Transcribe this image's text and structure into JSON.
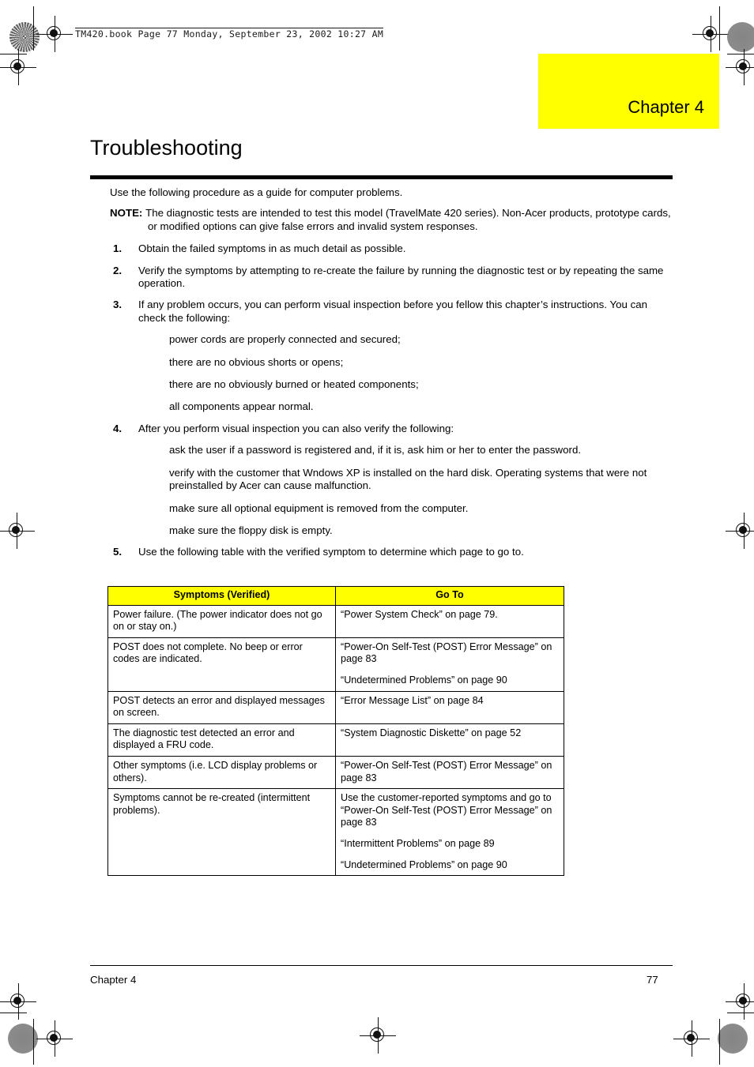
{
  "running_head": "TM420.book  Page 77  Monday, September 23, 2002  10:27 AM",
  "chapter_banner": {
    "label": "Chapter 4",
    "background_color": "#ffff00"
  },
  "title": "Troubleshooting",
  "intro": "Use the following procedure as a guide for computer problems.",
  "note": {
    "label": "NOTE:",
    "text": "The diagnostic tests are intended to test this model (TravelMate 420 series).  Non-Acer products, prototype cards, or modified options can give false errors and invalid system responses."
  },
  "steps": [
    {
      "num": "1.",
      "text": "Obtain the failed symptoms in as much detail as possible.",
      "subitems": []
    },
    {
      "num": "2.",
      "text": "Verify the symptoms by attempting to re-create the failure by running the diagnostic test or by repeating the same operation.",
      "subitems": []
    },
    {
      "num": "3.",
      "text": "If any problem occurs, you can perform visual inspection before you fellow this chapter’s instructions. You can check the following:",
      "subitems": [
        "power cords are properly connected and secured;",
        "there are no obvious shorts or opens;",
        "there are no obviously burned or heated components;",
        "all components appear normal."
      ]
    },
    {
      "num": "4.",
      "text": "After you perform visual inspection you can also verify the following:",
      "subitems": [
        "ask the user if a password is registered and, if it is, ask him or her to enter the password.",
        "verify with the customer that Wndows XP is installed on the hard disk. Operating systems that were not preinstalled by Acer can cause malfunction.",
        "make sure all optional equipment is removed from the computer.",
        "make sure the floppy disk is empty."
      ]
    },
    {
      "num": "5.",
      "text": "Use the following table with the verified symptom to determine which page to go to.",
      "subitems": []
    }
  ],
  "table": {
    "headers": [
      "Symptoms (Verified)",
      "Go To"
    ],
    "header_background": "#ffff00",
    "rows": [
      {
        "symptom": [
          "Power failure. (The power indicator does not go on or stay on.)"
        ],
        "goto": [
          "“Power System Check” on page 79."
        ]
      },
      {
        "symptom": [
          "POST does not complete. No beep or error codes are indicated."
        ],
        "goto": [
          "“Power-On Self-Test (POST) Error Message” on page 83",
          "“Undetermined Problems” on page 90"
        ]
      },
      {
        "symptom": [
          "POST detects an error and displayed messages on screen."
        ],
        "goto": [
          "“Error Message List” on page 84"
        ]
      },
      {
        "symptom": [
          "The diagnostic test detected an error and displayed a FRU code."
        ],
        "goto": [
          "“System Diagnostic Diskette” on page 52"
        ]
      },
      {
        "symptom": [
          "Other symptoms (i.e. LCD display problems or others)."
        ],
        "goto": [
          "“Power-On Self-Test (POST) Error Message” on page 83"
        ]
      },
      {
        "symptom": [
          "Symptoms cannot be re-created (intermittent problems)."
        ],
        "goto": [
          "Use the customer-reported symptoms and go to “Power-On Self-Test (POST) Error Message” on page 83",
          "“Intermittent Problems” on page 89",
          "“Undetermined Problems” on page 90"
        ]
      }
    ]
  },
  "footer": {
    "left": "Chapter 4",
    "page_number": "77"
  }
}
